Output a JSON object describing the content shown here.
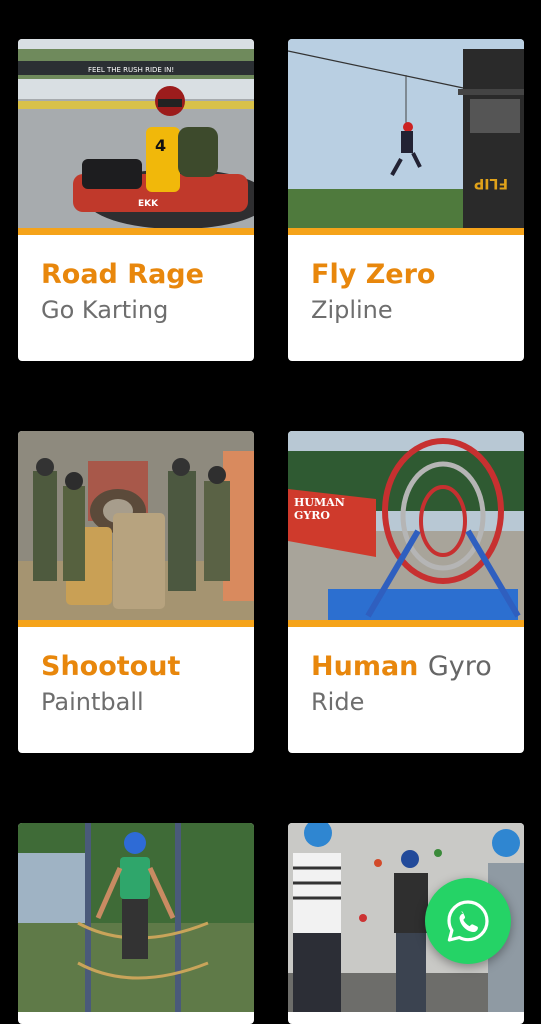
{
  "cards": [
    {
      "title": "Road Rage",
      "subtitle": "Go Karting",
      "image": "go-kart-photo"
    },
    {
      "title": "Fly Zero",
      "subtitle": "Zipline",
      "image": "zipline-photo"
    },
    {
      "title": "Shootout",
      "subtitle": "Paintball",
      "image": "paintball-photo"
    },
    {
      "title": "Human",
      "title_rest": "Gyro",
      "subtitle": "Ride",
      "image": "human-gyro-photo"
    },
    {
      "image": "rope-course-photo"
    },
    {
      "image": "climbing-wall-photo"
    }
  ],
  "photo_text": {
    "track_banner": "FEEL THE RUSH RIDE IN!",
    "kart_number": "4",
    "kart_brand": "EKK",
    "gyro_sign": [
      "HUMAN",
      "GYRO"
    ]
  },
  "floating_button": {
    "icon": "whatsapp-icon"
  },
  "colors": {
    "accent": "#e8870c",
    "bar": "#f5a31a",
    "whatsapp": "#25d366",
    "background": "#000000"
  }
}
